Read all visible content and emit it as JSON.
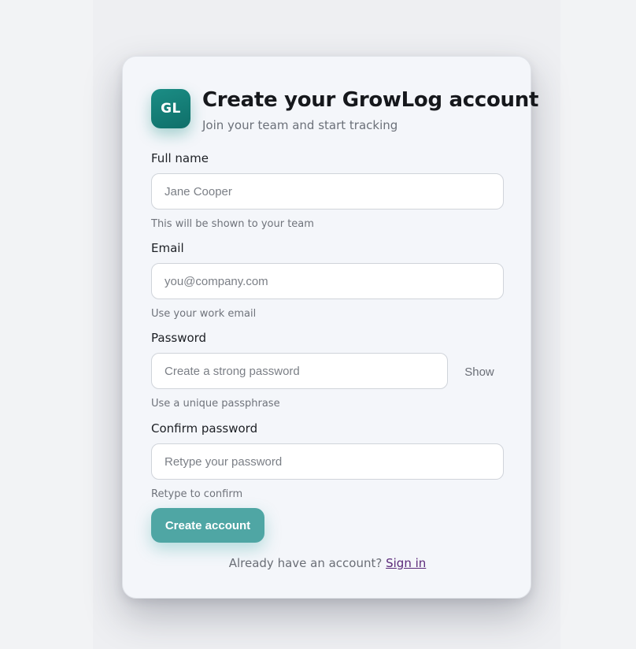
{
  "brand": {
    "logo_text": "GL",
    "accent_color": "#148a83"
  },
  "header": {
    "title": "Create your GrowLog account",
    "subtitle": "Join your team and start tracking"
  },
  "form": {
    "full_name": {
      "label": "Full name",
      "placeholder": "Jane Cooper",
      "value": "",
      "help": "This will be shown to your team"
    },
    "email": {
      "label": "Email",
      "placeholder": "you@company.com",
      "value": "",
      "help": "Use your work email"
    },
    "password": {
      "label": "Password",
      "placeholder": "Create a strong password",
      "value": "",
      "help": "Use a unique passphrase",
      "toggle_label": "Show"
    },
    "confirm_password": {
      "label": "Confirm password",
      "placeholder": "Retype your password",
      "value": "",
      "help": "Retype to confirm"
    },
    "submit_label": "Create account"
  },
  "footer": {
    "prompt": "Already have an account?",
    "link_label": "Sign in"
  }
}
